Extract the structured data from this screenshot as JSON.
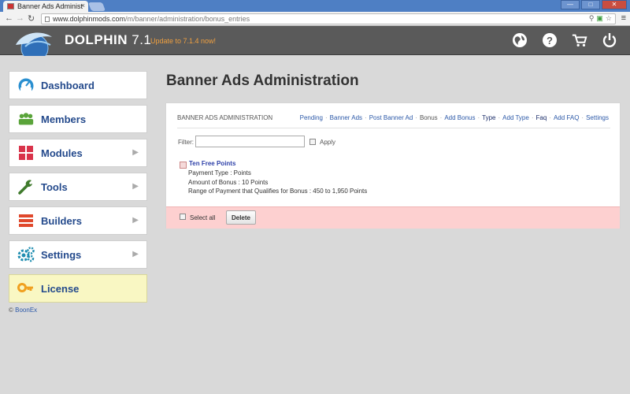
{
  "browser": {
    "tab_title": "Banner Ads Administ",
    "tab_close": "×",
    "url_host": "www.dolphinmods.com",
    "url_path": "/m/banner/administration/bonus_entries",
    "win_min": "—",
    "win_max": "□",
    "win_close": "✕"
  },
  "header": {
    "brand": "DOLPHIN",
    "version": "7.1",
    "update_text": "Update to 7.1.4 now!"
  },
  "sidebar": {
    "items": [
      {
        "label": "Dashboard",
        "icon": "dashboard-icon",
        "color": "#2a8fd0"
      },
      {
        "label": "Members",
        "icon": "members-icon",
        "color": "#5aa43a"
      },
      {
        "label": "Modules",
        "icon": "modules-icon",
        "color": "#d9334a"
      },
      {
        "label": "Tools",
        "icon": "wrench-icon",
        "color": "#3f7a2c"
      },
      {
        "label": "Builders",
        "icon": "builders-icon",
        "color": "#e0482c"
      },
      {
        "label": "Settings",
        "icon": "gears-icon",
        "color": "#1f8db0"
      },
      {
        "label": "License",
        "icon": "key-icon",
        "color": "#f0a020"
      }
    ],
    "copyright_symbol": "©",
    "copyright_link": "BoonEx"
  },
  "main": {
    "page_title": "Banner Ads Administration",
    "panel_heading": "BANNER ADS ADMINISTRATION",
    "links": [
      "Pending",
      "Banner Ads",
      "Post Banner Ad",
      "Bonus",
      "Add Bonus",
      "Type",
      "Add Type",
      "Faq",
      "Add FAQ",
      "Settings"
    ],
    "filter_label": "Filter:",
    "filter_value": "",
    "apply_label": "Apply",
    "entry": {
      "title": "Ten Free Points",
      "payment_type": "Payment Type : Points",
      "amount": "Amount of Bonus : 10 Points",
      "range": "Range of Payment that Qualifies for Bonus : 450 to 1,950 Points"
    },
    "select_all_label": "Select all",
    "delete_label": "Delete"
  }
}
